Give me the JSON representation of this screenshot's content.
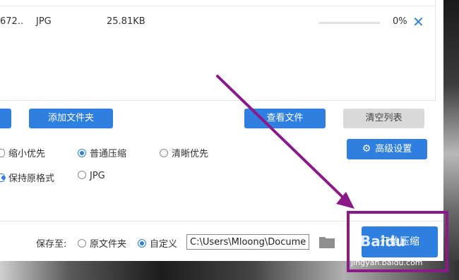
{
  "file_row": {
    "name": "672..",
    "format": "JPG",
    "size": "25.81KB",
    "progress_text": "0%",
    "progress": 0
  },
  "buttons": {
    "add_folder": "添加文件夹",
    "view_files": "查看文件",
    "clear_list": "清空列表",
    "advanced": "高级设置",
    "start": "开始压缩"
  },
  "compression_mode": {
    "options": [
      "缩小优先",
      "普通压缩",
      "清晰优先"
    ],
    "selected": "普通压缩"
  },
  "output_format": {
    "options": [
      "保持原格式",
      "JPG"
    ],
    "selected": "保持原格式"
  },
  "save_to": {
    "label": "保存至:",
    "options": [
      "原文件夹",
      "自定义"
    ],
    "selected": "自定义",
    "path": "C:\\Users\\Mloong\\Documents"
  },
  "watermark": {
    "text": "Baidu",
    "url": "jingyan.baidu.com"
  },
  "colors": {
    "accent": "#2f7fe0",
    "annotation": "#8a1a8a"
  }
}
